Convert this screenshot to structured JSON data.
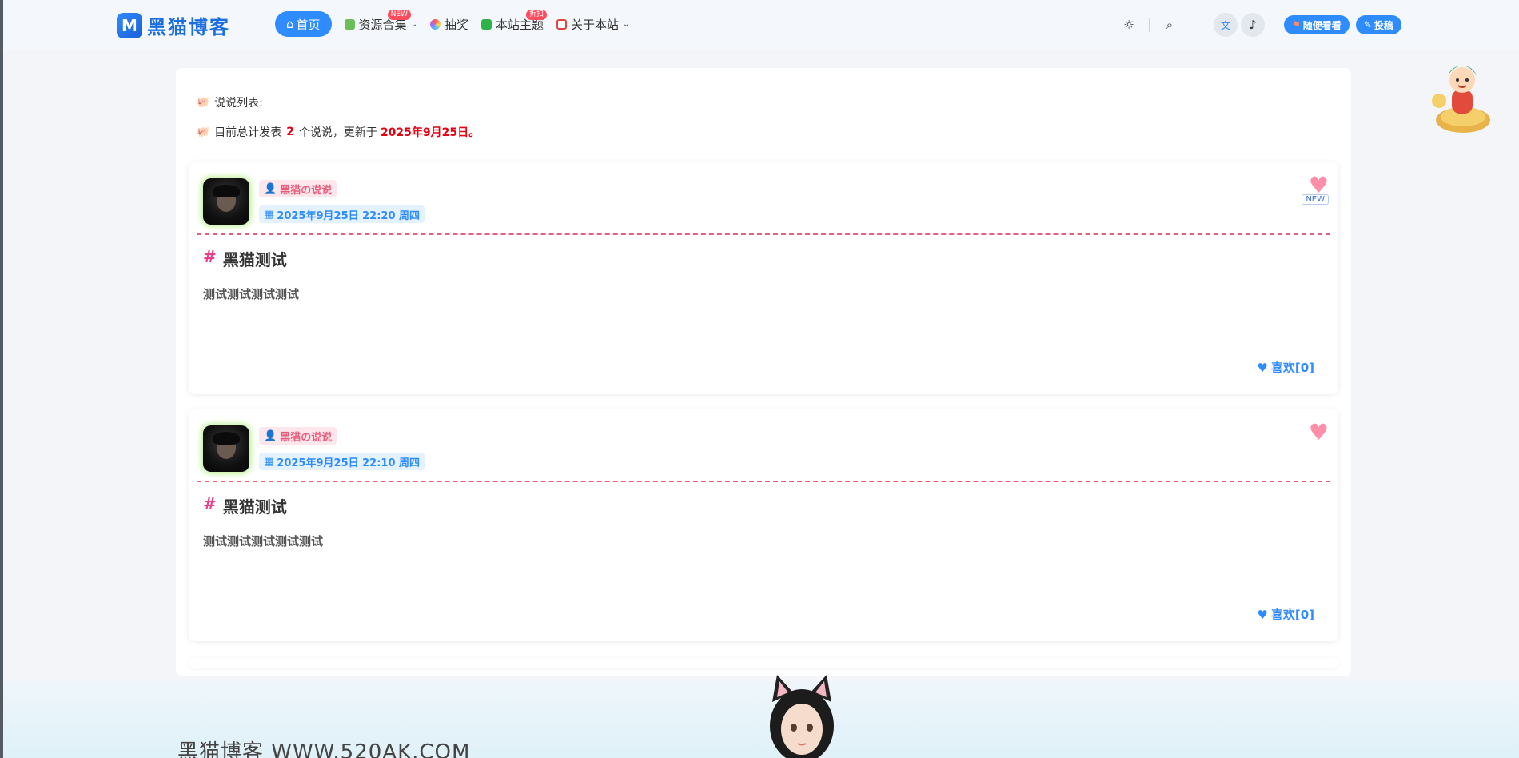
{
  "header": {
    "logo_text": "黑猫博客",
    "logo_mark": "M",
    "nav": [
      {
        "label": "首页",
        "icon": "home-icon"
      },
      {
        "label": "资源合集",
        "icon": "gift-icon",
        "badge": "NEW",
        "has_dropdown": true
      },
      {
        "label": "抽奖",
        "icon": "wheel-icon"
      },
      {
        "label": "本站主题",
        "icon": "theme-icon",
        "badge": "折扣"
      },
      {
        "label": "关于本站",
        "icon": "about-icon",
        "has_dropdown": true
      }
    ],
    "buttons": {
      "convenient": "随便看看",
      "submit": "投稿"
    }
  },
  "intro": {
    "list_label": "说说列表:",
    "summary_prefix": "目前总计发表",
    "count": "2",
    "summary_middle": "个说说，更新于",
    "updated": "2025年9月25日",
    "summary_end": "。"
  },
  "posts": [
    {
      "author": "黑猫の说说",
      "datetime": "2025年9月25日 22:20 周四",
      "title": "黑猫测试",
      "body": "测试测试测试测试",
      "likes": "喜欢[0]",
      "new_label": "NEW"
    },
    {
      "author": "黑猫の说说",
      "datetime": "2025年9月25日 22:10 周四",
      "title": "黑猫测试",
      "body": "测试测试测试测试测试",
      "likes": "喜欢[0]"
    }
  ],
  "footer": {
    "title": "黑猫博客 WWW.520AK.COM"
  },
  "colors": {
    "accent": "#2f8cff",
    "pink": "#e85d7c",
    "red": "#e60012"
  }
}
